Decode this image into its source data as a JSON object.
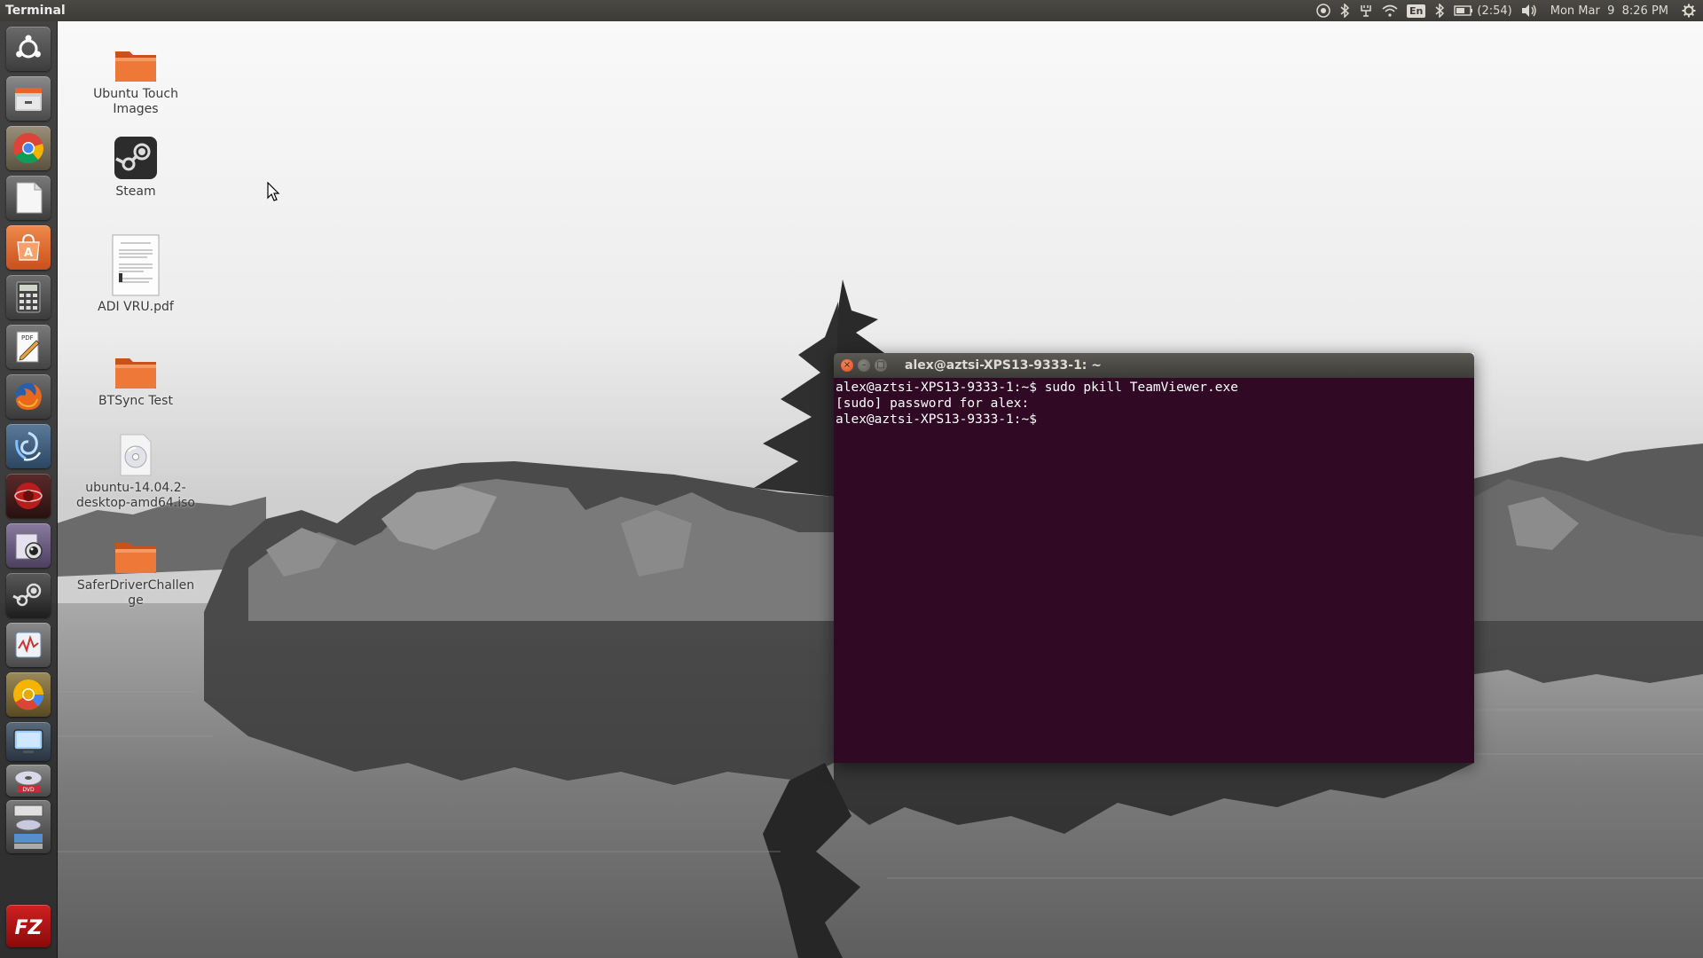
{
  "top_panel": {
    "app_title": "Terminal",
    "battery": "(2:54)",
    "language": "En",
    "clock": "Mon Mar  9  8:26 PM",
    "icons": [
      "telegram-icon",
      "bluetooth-icon",
      "network-tray-icon",
      "wifi-icon",
      "keyboard-language-icon",
      "bluetooth-icon",
      "battery-icon",
      "volume-icon",
      "gear-icon"
    ]
  },
  "launcher": {
    "items": [
      {
        "name": "dash",
        "icon": "ubuntu-logo-icon"
      },
      {
        "name": "files",
        "icon": "file-cabinet-icon"
      },
      {
        "name": "chrome",
        "icon": "chrome-icon"
      },
      {
        "name": "text-editor",
        "icon": "blank-document-icon"
      },
      {
        "name": "software-center",
        "icon": "shopping-bag-icon"
      },
      {
        "name": "calculator",
        "icon": "calculator-icon"
      },
      {
        "name": "pdf-editor",
        "icon": "pdf-pen-icon"
      },
      {
        "name": "firefox",
        "icon": "firefox-icon"
      },
      {
        "name": "swirl-app",
        "icon": "swirl-icon"
      },
      {
        "name": "red-app",
        "icon": "red-globe-icon"
      },
      {
        "name": "webcam",
        "icon": "webcam-icon"
      },
      {
        "name": "steam",
        "icon": "steam-icon"
      },
      {
        "name": "monitor",
        "icon": "system-monitor-icon"
      },
      {
        "name": "chrome-canary",
        "icon": "chrome-yellow-icon"
      },
      {
        "name": "virtualbox",
        "icon": "screen-icon"
      },
      {
        "name": "disk-burner",
        "icon": "disc-icon"
      },
      {
        "name": "workspaces",
        "icon": "workspace-icon"
      },
      {
        "name": "filezilla",
        "icon": "filezilla-icon"
      }
    ]
  },
  "desktop": {
    "icons": [
      {
        "label": "Ubuntu Touch Images",
        "icon": "folder-icon"
      },
      {
        "label": "Steam",
        "icon": "steam-icon"
      },
      {
        "label": "ADI VRU.pdf",
        "icon": "pdf-document-icon"
      },
      {
        "label": "BTSync Test",
        "icon": "folder-icon"
      },
      {
        "label": "ubuntu-14.04.2-desktop-amd64.iso",
        "icon": "disc-image-icon"
      },
      {
        "label": "SaferDriverChallenge",
        "icon": "folder-icon"
      }
    ]
  },
  "terminal": {
    "title": "alex@aztsi-XPS13-9333-1: ~",
    "close_glyph": "×",
    "minimize_glyph": "–",
    "maximize_glyph": "□",
    "lines": [
      "alex@aztsi-XPS13-9333-1:~$ sudo pkill TeamViewer.exe",
      "[sudo] password for alex:",
      "alex@aztsi-XPS13-9333-1:~$ "
    ],
    "background_color": "#300a24"
  },
  "colors": {
    "panel": "#3c3b37",
    "close_button": "#df4a16",
    "folder": "#e9642a"
  }
}
